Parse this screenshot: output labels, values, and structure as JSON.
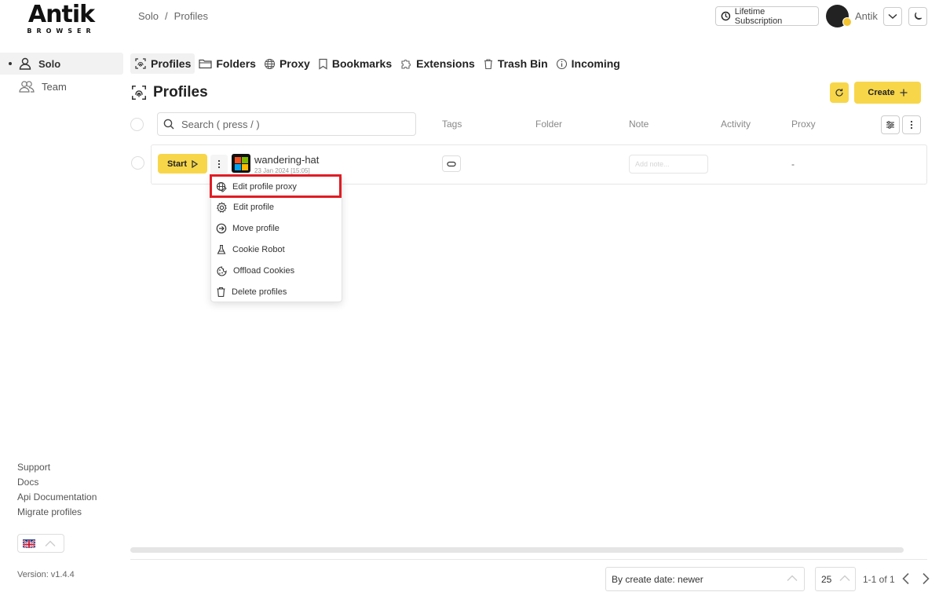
{
  "logo": {
    "main": "Antik",
    "sub": "BROWSER"
  },
  "breadcrumb": {
    "root": "Solo",
    "separator": "/",
    "current": "Profiles"
  },
  "header": {
    "subscription_label": "Lifetime Subscription",
    "user_name": "Antik"
  },
  "sidebar": {
    "items": [
      {
        "label": "Solo",
        "icon": "user-icon",
        "active": true
      },
      {
        "label": "Team",
        "icon": "users-icon",
        "active": false
      }
    ],
    "links": [
      "Support",
      "Docs",
      "Api Documentation",
      "Migrate profiles"
    ],
    "version": "Version: v1.4.4"
  },
  "tabs": [
    {
      "label": "Profiles",
      "icon": "fingerprint-icon",
      "active": true
    },
    {
      "label": "Folders",
      "icon": "folder-icon"
    },
    {
      "label": "Proxy",
      "icon": "globe-icon"
    },
    {
      "label": "Bookmarks",
      "icon": "bookmark-icon"
    },
    {
      "label": "Extensions",
      "icon": "puzzle-icon"
    },
    {
      "label": "Trash Bin",
      "icon": "trash-icon"
    },
    {
      "label": "Incoming",
      "icon": "info-icon"
    }
  ],
  "main": {
    "title": "Profiles",
    "create_label": "Create"
  },
  "table": {
    "search_placeholder": "Search ( press / )",
    "columns": [
      "Tags",
      "Folder",
      "Note",
      "Activity",
      "Proxy"
    ],
    "rows": [
      {
        "start_label": "Start",
        "name": "wandering-hat",
        "date": "23 Jan 2024 [15:05]",
        "note_placeholder": "Add note...",
        "proxy": "-"
      }
    ]
  },
  "context_menu": {
    "items": [
      {
        "label": "Edit profile proxy",
        "icon": "globe-edit-icon",
        "highlighted": true
      },
      {
        "label": "Edit profile",
        "icon": "gear-icon"
      },
      {
        "label": "Move profile",
        "icon": "arrow-right-circle-icon"
      },
      {
        "label": "Cookie Robot",
        "icon": "flask-icon"
      },
      {
        "label": "Offload Cookies",
        "icon": "cookie-icon"
      },
      {
        "label": "Delete profiles",
        "icon": "trash-icon"
      }
    ]
  },
  "footer": {
    "sort_label": "By create date: newer",
    "per_page": "25",
    "page_info": "1-1 of 1"
  },
  "colors": {
    "accent": "#f7d64a",
    "highlight": "#e01c24"
  }
}
